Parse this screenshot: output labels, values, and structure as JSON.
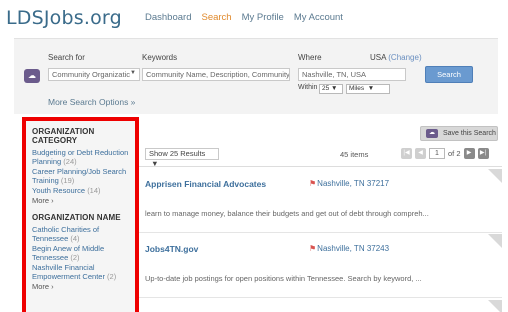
{
  "header": {
    "logo": "LDSJobs.org",
    "nav": [
      {
        "label": "Dashboard"
      },
      {
        "label": "Search",
        "active": true
      },
      {
        "label": "My Profile"
      },
      {
        "label": "My Account"
      }
    ]
  },
  "search": {
    "search_for_label": "Search for",
    "search_for_value": "Community Organizatic",
    "keywords_label": "Keywords",
    "keywords_placeholder": "Community Name, Description, Community L",
    "where_label": "Where",
    "country": "USA",
    "change_link": "(Change)",
    "where_value": "Nashville, TN, USA",
    "within_label": "Within",
    "radius_value": "25",
    "units_value": "Miles",
    "search_button": "Search",
    "more_options": "More Search Options »"
  },
  "sidebar": {
    "category_heading": "ORGANIZATION CATEGORY",
    "categories": [
      {
        "name": "Budgeting or Debt Reduction Planning",
        "count": "(24)"
      },
      {
        "name": "Career Planning/Job Search Training",
        "count": "(19)"
      },
      {
        "name": "Youth Resource",
        "count": "(14)"
      }
    ],
    "category_more": "More ›",
    "name_heading": "ORGANIZATION NAME",
    "names": [
      {
        "name": "Catholic Charities of Tennessee",
        "count": "(4)"
      },
      {
        "name": "Begin Anew of Middle Tennessee",
        "count": "(2)"
      },
      {
        "name": "Nashville Financial Empowerment Center",
        "count": "(2)"
      }
    ],
    "name_more": "More ›"
  },
  "results": {
    "save_search": "Save this Search",
    "show_results": "Show 25 Results",
    "items_count": "45 items",
    "page_current": "1",
    "page_total": "of 2",
    "cards": [
      {
        "title": "Apprisen Financial Advocates",
        "location": "Nashville, TN 37217",
        "description": "learn to manage money, balance their budgets and get out of debt through compreh..."
      },
      {
        "title": "Jobs4TN.gov",
        "location": "Nashville, TN 37243",
        "description": "Up-to-date job postings for open positions within Tennessee. Search by keyword, ..."
      }
    ]
  },
  "colors": {
    "accent_orange": "#e08a2d",
    "link_blue": "#3d6f9c",
    "highlight_red": "#ee0000",
    "search_button": "#6a9ad0"
  },
  "icons": [
    "cloud-icon",
    "chevron-down-icon",
    "map-pin-icon",
    "pager-first-icon",
    "pager-prev-icon",
    "pager-next-icon",
    "pager-last-icon"
  ]
}
